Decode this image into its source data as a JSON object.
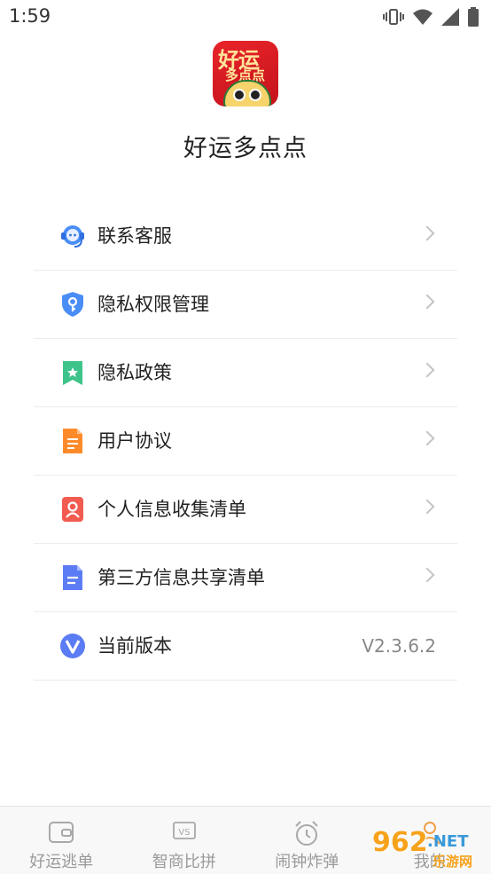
{
  "status": {
    "time": "1:59"
  },
  "app": {
    "name": "好运多点点",
    "logo_line1": "好运",
    "logo_line2": "多点点"
  },
  "menu": {
    "items": [
      {
        "label": "联系客服",
        "icon": "headset-icon"
      },
      {
        "label": "隐私权限管理",
        "icon": "shield-key-icon"
      },
      {
        "label": "隐私政策",
        "icon": "bookmark-star-icon"
      },
      {
        "label": "用户协议",
        "icon": "document-icon"
      },
      {
        "label": "个人信息收集清单",
        "icon": "person-card-icon"
      },
      {
        "label": "第三方信息共享清单",
        "icon": "file-lines-icon"
      }
    ],
    "version": {
      "label": "当前版本",
      "value": "V2.3.6.2",
      "icon": "v-logo-icon"
    }
  },
  "tabs": [
    {
      "label": "好运逃单",
      "icon": "wallet-icon"
    },
    {
      "label": "智商比拼",
      "icon": "vs-icon"
    },
    {
      "label": "闹钟炸弹",
      "icon": "alarm-clock-icon"
    },
    {
      "label": "我的",
      "icon": "profile-icon"
    }
  ],
  "watermark": {
    "brand": "962",
    "suffix": ".NET",
    "subtitle": "乐游网"
  },
  "colors": {
    "icon_blue": "#4a8df7",
    "icon_green": "#3ec38a",
    "icon_orange": "#ff8a2a",
    "icon_red": "#f25b50",
    "icon_indigo": "#5b7cf5"
  }
}
